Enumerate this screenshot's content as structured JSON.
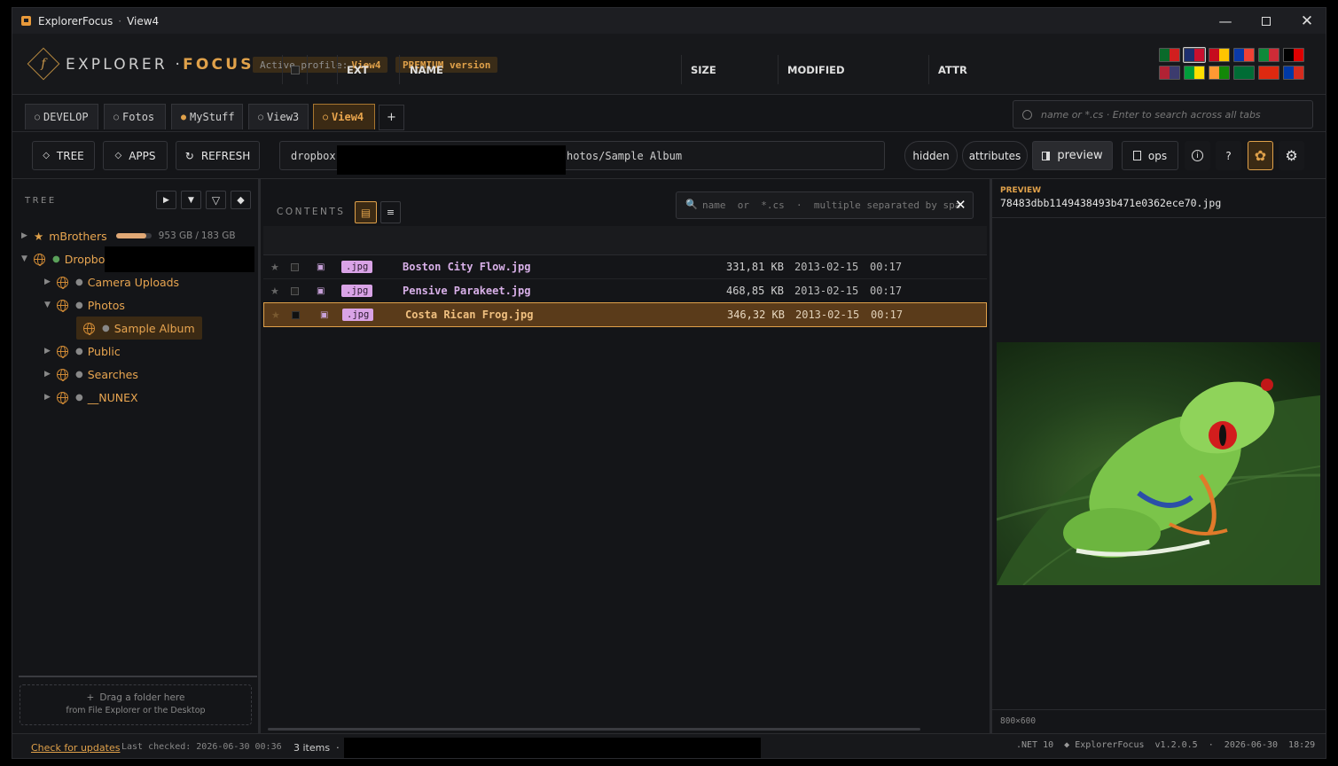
{
  "window": {
    "app": "ExplorerFocus",
    "sep": "·",
    "view": "View4"
  },
  "header": {
    "logo_letter": "f",
    "logo_main": "EXPLORER ·",
    "logo_focus": "FOCUS",
    "profile_label": "Active profile:",
    "profile_name": "View4",
    "premium": "PREMIUM version",
    "flags": [
      {
        "name": "portugal",
        "c1": "#0a6a2a",
        "c2": "#d11f1f"
      },
      {
        "name": "uk",
        "c1": "#1d2f6f",
        "c2": "#c8102e",
        "selected": true
      },
      {
        "name": "spain",
        "c1": "#c60b1e",
        "c2": "#ffc400"
      },
      {
        "name": "france",
        "c1": "#0b3aa8",
        "c2": "#ef4135"
      },
      {
        "name": "italy",
        "c1": "#0f8a3a",
        "c2": "#ce2b37"
      },
      {
        "name": "germany",
        "c1": "#000000",
        "c2": "#dd0000"
      },
      {
        "name": "usa",
        "c1": "#b22234",
        "c2": "#3c3b6e"
      },
      {
        "name": "brazil",
        "c1": "#009c3b",
        "c2": "#ffdf00"
      },
      {
        "name": "india",
        "c1": "#ff9933",
        "c2": "#138808"
      },
      {
        "name": "saudi",
        "c1": "#006c35",
        "c2": "#006c35"
      },
      {
        "name": "china",
        "c1": "#de2910",
        "c2": "#de2910"
      },
      {
        "name": "russia",
        "c1": "#0039a6",
        "c2": "#d52b1e"
      }
    ]
  },
  "tabs": [
    {
      "label": "DEVELOP",
      "dot": "○"
    },
    {
      "label": "Fotos",
      "dot": "○"
    },
    {
      "label": "MyStuff",
      "dot": "●"
    },
    {
      "label": "View3",
      "dot": "○"
    },
    {
      "label": "View4",
      "dot": "○"
    }
  ],
  "tab_add": "+",
  "global_search": {
    "placeholder": "name or *.cs  ·  Enter to search across all tabs"
  },
  "toolbar": {
    "tree": "TREE",
    "apps": "APPS",
    "refresh": "REFRESH",
    "path_start": "dropbox",
    "path_end": "hotos/Sample Album",
    "hidden": "hidden",
    "attributes": "attributes",
    "preview": "preview",
    "ops": "ops",
    "info": "i",
    "help": "?"
  },
  "tree": {
    "title": "TREE",
    "items": [
      {
        "label": "mBrothers",
        "used": "953 GB",
        "total": "183 GB"
      },
      {
        "label": "Dropbo"
      },
      {
        "label": "Camera Uploads"
      },
      {
        "label": "Photos"
      },
      {
        "label": "Sample Album"
      },
      {
        "label": "Public"
      },
      {
        "label": "Searches"
      },
      {
        "label": "__NUNEX"
      }
    ],
    "drop_title": "Drag a folder here",
    "drop_sub": "from File Explorer or the Desktop"
  },
  "contents": {
    "title": "CONTENTS",
    "filter_placeholder": "name  or  *.cs  ·  multiple separated by spa",
    "columns": [
      "EXT",
      "NAME",
      "SIZE",
      "MODIFIED",
      "ATTR"
    ],
    "files": [
      {
        "ext": ".jpg",
        "name": "Boston City Flow.jpg",
        "size": "331,81 KB",
        "date": "2013-02-15",
        "time": "00:17"
      },
      {
        "ext": ".jpg",
        "name": "Pensive Parakeet.jpg",
        "size": "468,85 KB",
        "date": "2013-02-15",
        "time": "00:17"
      },
      {
        "ext": ".jpg",
        "name": "Costa Rican Frog.jpg",
        "size": "346,32 KB",
        "date": "2013-02-15",
        "time": "00:17"
      }
    ]
  },
  "preview": {
    "label": "PREVIEW",
    "filename": "78483dbb1149438493b471e0362ece70.jpg",
    "dims": "800×600"
  },
  "status": {
    "check_updates": "Check for updates",
    "last_checked": "Last checked: 2026-06-30 00:36",
    "items": "3 items  ·  dr",
    "right": ".NET 10  ◆ ExplorerFocus  v1.2.0.5  ·  2026-06-30  18:29"
  }
}
